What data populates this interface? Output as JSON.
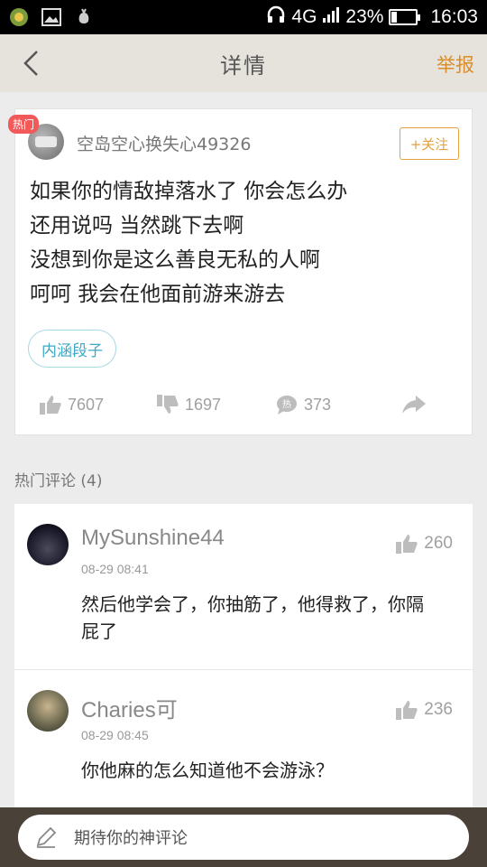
{
  "status_bar": {
    "network": "4G",
    "battery_percent": "23%",
    "battery_level": 0.23,
    "time": "16:03"
  },
  "header": {
    "title": "详情",
    "report_label": "举报"
  },
  "post": {
    "badge": "热门",
    "author": "空岛空心换失心49326",
    "follow_label": "+关注",
    "lines": [
      "如果你的情敌掉落水了 你会怎么办",
      "还用说吗 当然跳下去啊",
      "没想到你是这么善良无私的人啊",
      "呵呵 我会在他面前游来游去"
    ],
    "tag": "内涵段子",
    "likes": "7607",
    "dislikes": "1697",
    "comments": "373"
  },
  "comments_section": {
    "title": "热门评论 (4)",
    "items": [
      {
        "user": "MySunshine44",
        "time": "08-29 08:41",
        "likes": "260",
        "text": "然后他学会了，你抽筋了，他得救了，你隔屁了"
      },
      {
        "user": "Charies可",
        "time": "08-29 08:45",
        "likes": "236",
        "text": "你他麻的怎么知道他不会游泳？"
      }
    ]
  },
  "comment_bar": {
    "placeholder": "期待你的神评论"
  },
  "colors": {
    "accent_orange": "#d98e2b",
    "tag_blue": "#3ea7c3",
    "hot_red": "#f25a5a",
    "bottom_bar": "#4a4139"
  }
}
